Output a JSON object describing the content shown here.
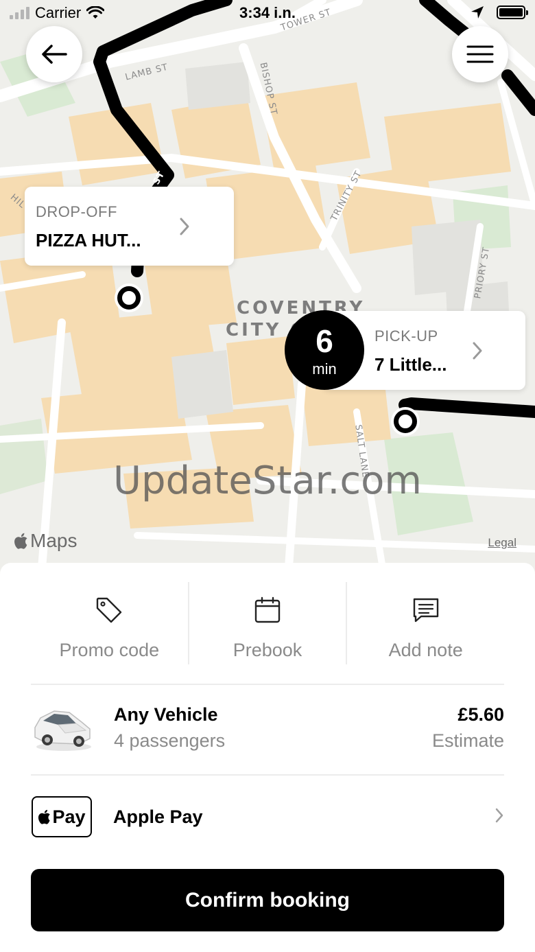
{
  "status_bar": {
    "carrier": "Carrier",
    "time": "3:34 i.n."
  },
  "map": {
    "streets": [
      "TOWER ST",
      "LAMB ST",
      "BISHOP ST",
      "TRINITY ST",
      "PRIORY ST",
      "SALT LANE",
      "ST",
      "HIL"
    ],
    "area_label_line1": "COVENTRY",
    "area_label_line2": "CITY C",
    "watermark": "UpdateStar.com",
    "maps_logo": "Maps",
    "legal": "Legal",
    "route_color": "#000000",
    "building_color": "#f6dcb2"
  },
  "dropoff": {
    "type_label": "DROP-OFF",
    "place": "PIZZA HUT..."
  },
  "pickup": {
    "type_label": "PICK-UP",
    "place": "7 Little...",
    "eta_value": "6",
    "eta_unit": "min"
  },
  "actions": [
    {
      "label": "Promo code",
      "icon": "tag-icon"
    },
    {
      "label": "Prebook",
      "icon": "calendar-icon"
    },
    {
      "label": "Add note",
      "icon": "note-icon"
    }
  ],
  "vehicle": {
    "name": "Any Vehicle",
    "capacity": "4 passengers",
    "price": "£5.60",
    "price_note": "Estimate",
    "icon": "car-icon"
  },
  "payment": {
    "badge": "Pay",
    "method": "Apple Pay"
  },
  "confirm_label": "Confirm booking"
}
